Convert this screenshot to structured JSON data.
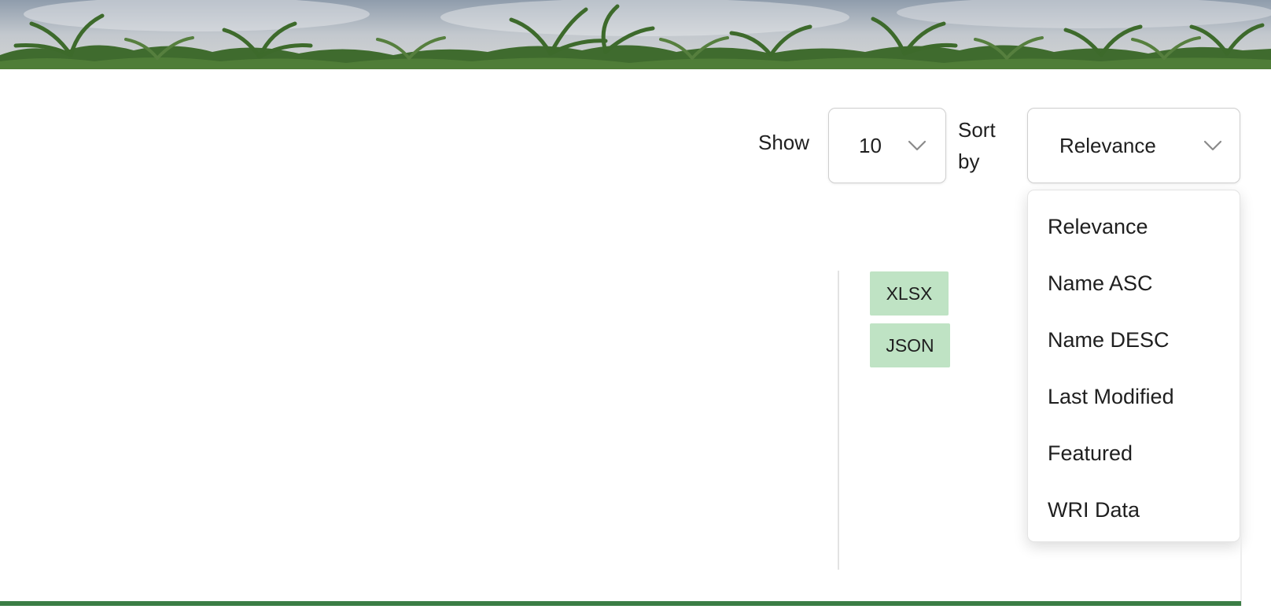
{
  "hero": {
    "image": "palm-trees-banner"
  },
  "toolbar": {
    "show_label": "Show",
    "page_size": {
      "value": "10",
      "icon": "chevron-down-icon"
    },
    "sort_label": "Sort by",
    "sort": {
      "value": "Relevance",
      "icon": "chevron-down-icon",
      "expanded": true
    }
  },
  "sort_menu": {
    "items": [
      {
        "label": "Relevance"
      },
      {
        "label": "Name ASC"
      },
      {
        "label": "Name DESC"
      },
      {
        "label": "Last Modified"
      },
      {
        "label": "Featured"
      },
      {
        "label": "WRI Data"
      }
    ]
  },
  "formats": {
    "badges": [
      {
        "label": "XLSX"
      },
      {
        "label": "JSON"
      }
    ],
    "badge_color": "#bfe3c4"
  },
  "colors": {
    "accent_rule": "#3b7d45",
    "select_border": "#cfcfcf",
    "chevron": "#8a8a8a"
  }
}
